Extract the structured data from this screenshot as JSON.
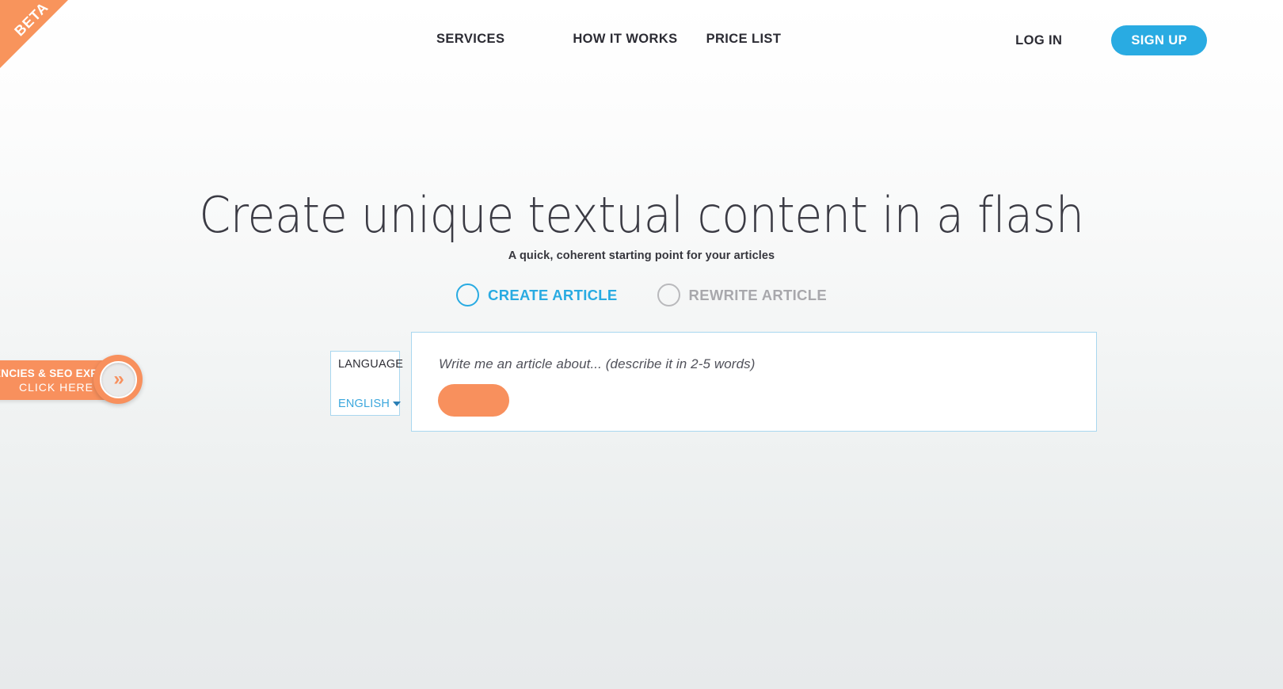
{
  "ribbon": {
    "label": "BETA",
    "color": "#f8945c"
  },
  "nav": {
    "links": [
      {
        "label": "SERVICES",
        "name": "nav-link-services"
      },
      {
        "label": "HOW IT WORKS",
        "name": "nav-link-how-it-works"
      },
      {
        "label": "PRICE LIST",
        "name": "nav-link-price-list"
      }
    ],
    "login_label": "LOG IN",
    "signup_label": "SIGN UP",
    "signup_color": "#29abe2"
  },
  "hero": {
    "title": "Create unique textual content in a flash",
    "subtitle": "A quick, coherent starting point for your articles"
  },
  "modes": {
    "options": [
      {
        "label": "CREATE ARTICLE",
        "selected": true,
        "color": "#29abe2"
      },
      {
        "label": "REWRITE ARTICLE",
        "selected": false,
        "color": "#a8a8ac"
      }
    ]
  },
  "language": {
    "label": "LANGUAGE",
    "value": "ENGLISH",
    "options": [
      "ENGLISH"
    ]
  },
  "prompt": {
    "placeholder": "Write me an article about... (describe it in 2-5 words)",
    "value": "",
    "button_label": "",
    "button_color": "#f8905d"
  },
  "promo": {
    "line1": "GENCIES & SEO EXPERTS",
    "line2": "CLICK HERE",
    "chevrons": "»",
    "color": "#f8905d"
  }
}
